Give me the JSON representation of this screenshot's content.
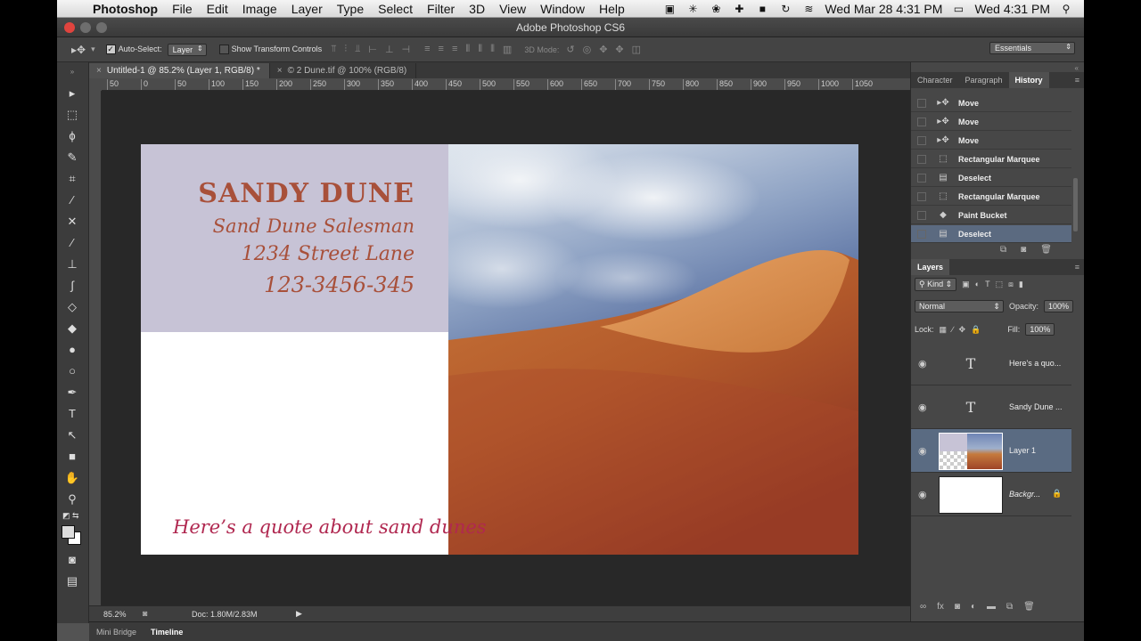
{
  "menubar": {
    "app_name": "Photoshop",
    "menus": [
      "File",
      "Edit",
      "Image",
      "Layer",
      "Type",
      "Select",
      "Filter",
      "3D",
      "View",
      "Window",
      "Help"
    ],
    "clock1": "Wed Mar 28  4:31 PM",
    "clock2": "Wed 4:31 PM"
  },
  "window": {
    "title": "Adobe Photoshop CS6"
  },
  "options": {
    "auto_select_label": "Auto-Select:",
    "auto_select_value": "Layer",
    "show_transform_label": "Show Transform Controls",
    "mode_3d_label": "3D Mode:",
    "workspace": "Essentials"
  },
  "doc_tabs": [
    {
      "label": "Untitled-1 @ 85.2% (Layer 1, RGB/8) *"
    },
    {
      "label": "© 2 Dune.tif @ 100% (RGB/8)"
    }
  ],
  "ruler_ticks": [
    "50",
    "0",
    "50",
    "100",
    "150",
    "200",
    "250",
    "300",
    "350",
    "400",
    "450",
    "500",
    "550",
    "600",
    "650",
    "700",
    "750",
    "800",
    "850",
    "900",
    "950",
    "1000",
    "1050"
  ],
  "card": {
    "name": "SANDY DUNE",
    "title": "Sand Dune Salesman",
    "address": "1234 Street Lane",
    "phone": "123-3456-345",
    "quote": "Here’s a quote about sand dunes"
  },
  "status": {
    "zoom": "85.2%",
    "doc": "Doc: 1.80M/2.83M"
  },
  "bottom_tabs": [
    "Mini Bridge",
    "Timeline"
  ],
  "history_panel": {
    "tabs": [
      "Character",
      "Paragraph",
      "History"
    ],
    "items": [
      {
        "icon": "move-icon",
        "label": "Move"
      },
      {
        "icon": "move-icon",
        "label": "Move"
      },
      {
        "icon": "move-icon",
        "label": "Move"
      },
      {
        "icon": "marquee-icon",
        "label": "Rectangular Marquee"
      },
      {
        "icon": "document-icon",
        "label": "Deselect"
      },
      {
        "icon": "marquee-icon",
        "label": "Rectangular Marquee"
      },
      {
        "icon": "paint-bucket-icon",
        "label": "Paint Bucket"
      },
      {
        "icon": "document-icon",
        "label": "Deselect"
      }
    ]
  },
  "layers_panel": {
    "tab": "Layers",
    "filter_kind": "Kind",
    "blend_mode": "Normal",
    "opacity_label": "Opacity:",
    "opacity_value": "100%",
    "lock_label": "Lock:",
    "fill_label": "Fill:",
    "fill_value": "100%",
    "layers": [
      {
        "name": "Here's a quo..."
      },
      {
        "name": "Sandy Dune ..."
      },
      {
        "name": "Layer 1"
      },
      {
        "name": "Backgr..."
      }
    ]
  }
}
